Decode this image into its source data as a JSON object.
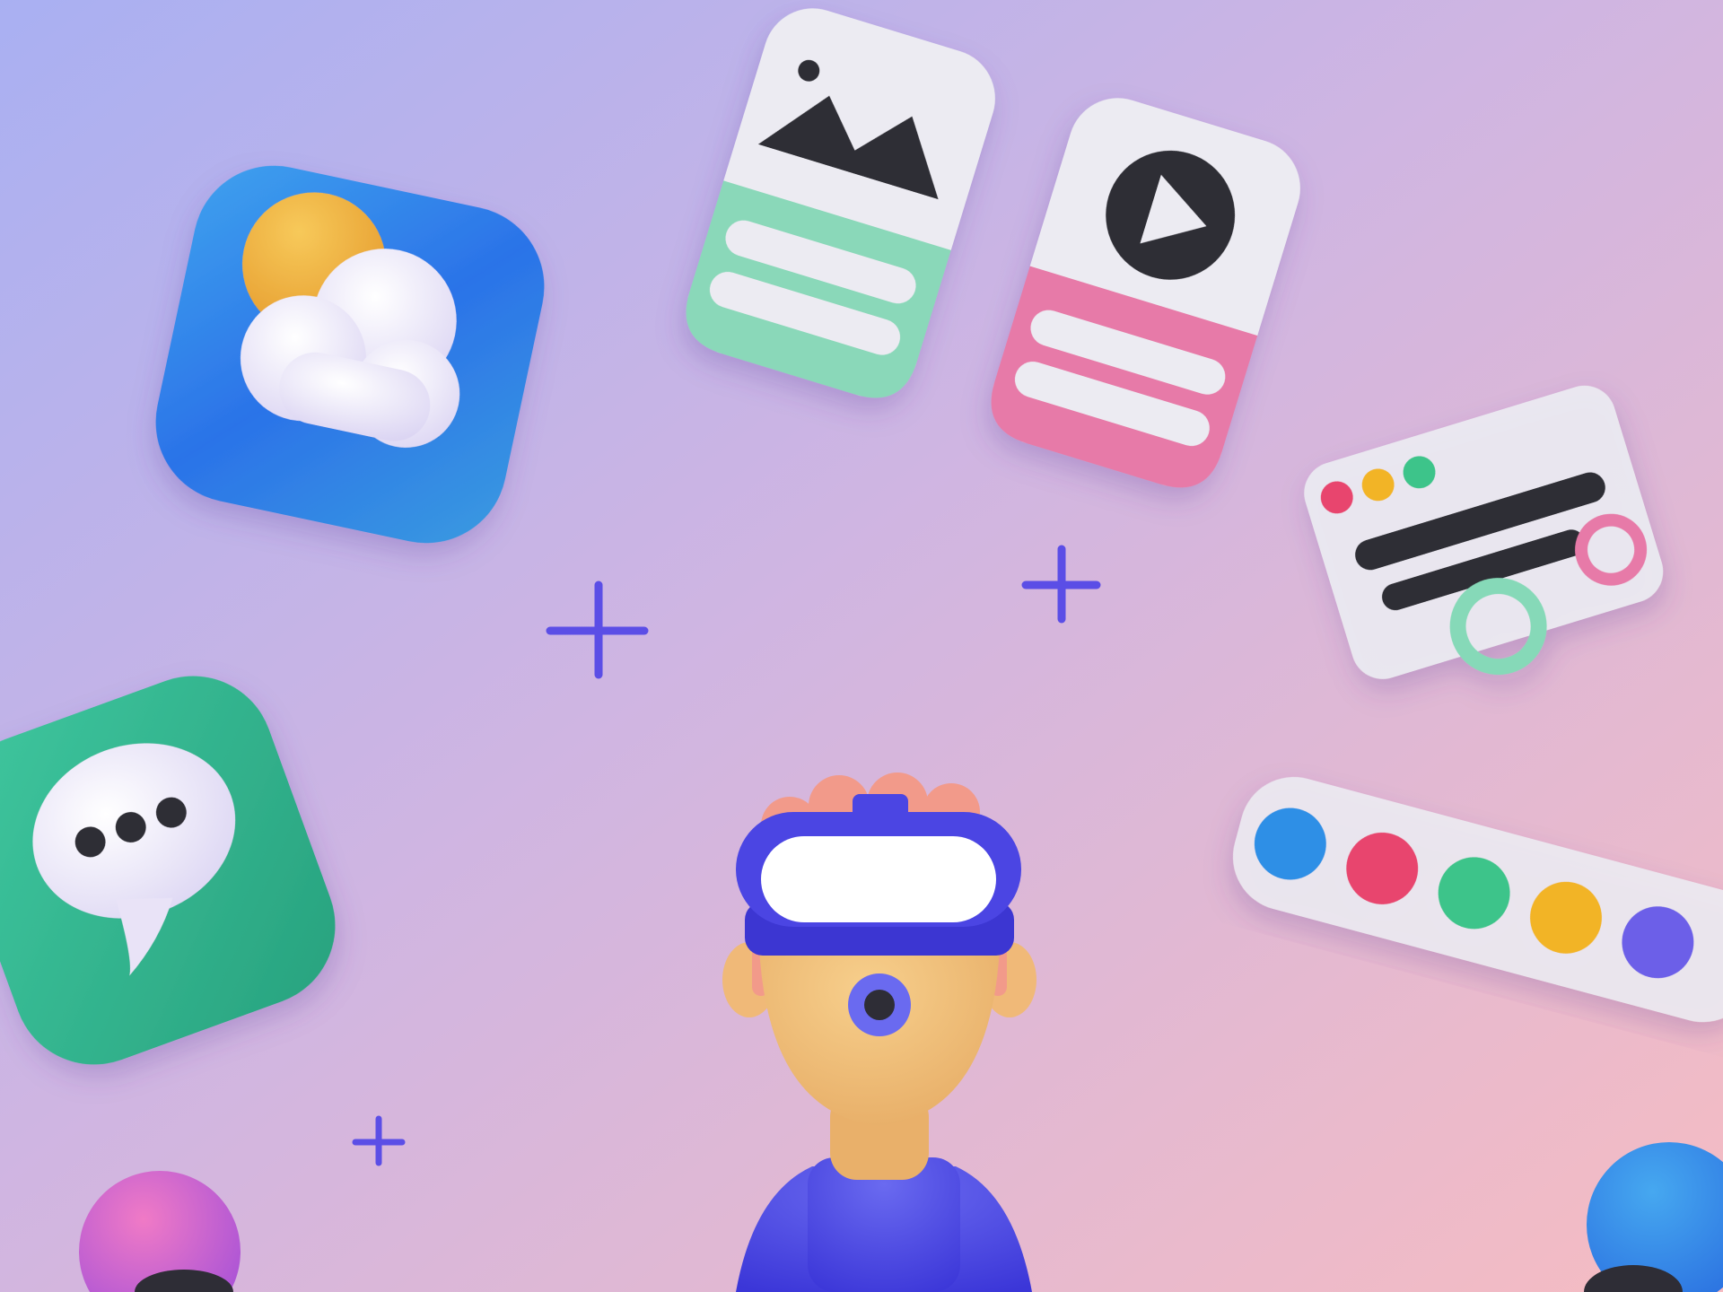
{
  "scene": {
    "description_icons": [
      "weather-app-icon",
      "image-card-icon",
      "video-card-icon",
      "window-card-icon",
      "chat-app-icon",
      "color-palette-icon",
      "vr-character"
    ],
    "colors": {
      "bg_top_left": "#a8aef0",
      "bg_mid": "#d4b6e0",
      "bg_bottom_right": "#f3bcc6",
      "accent_purple": "#5b4ee6",
      "weather_blue": "#2f8fe6",
      "chat_green": "#2fb38a",
      "card_mint": "#86d9b8",
      "card_pink": "#e77aa8",
      "card_white": "#ecebf2",
      "dark": "#2e2d36",
      "sun_yellow": "#f2b73a",
      "headset_blue": "#4b45e3",
      "skin": "#f1c07a",
      "hair": "#f29a8a"
    },
    "palette_dots": [
      "#2f8fe6",
      "#e8456e",
      "#3cc48a",
      "#f2b428",
      "#6c5fe8"
    ],
    "window_dots": [
      "#e8456e",
      "#f2b428",
      "#3cc48a"
    ]
  }
}
